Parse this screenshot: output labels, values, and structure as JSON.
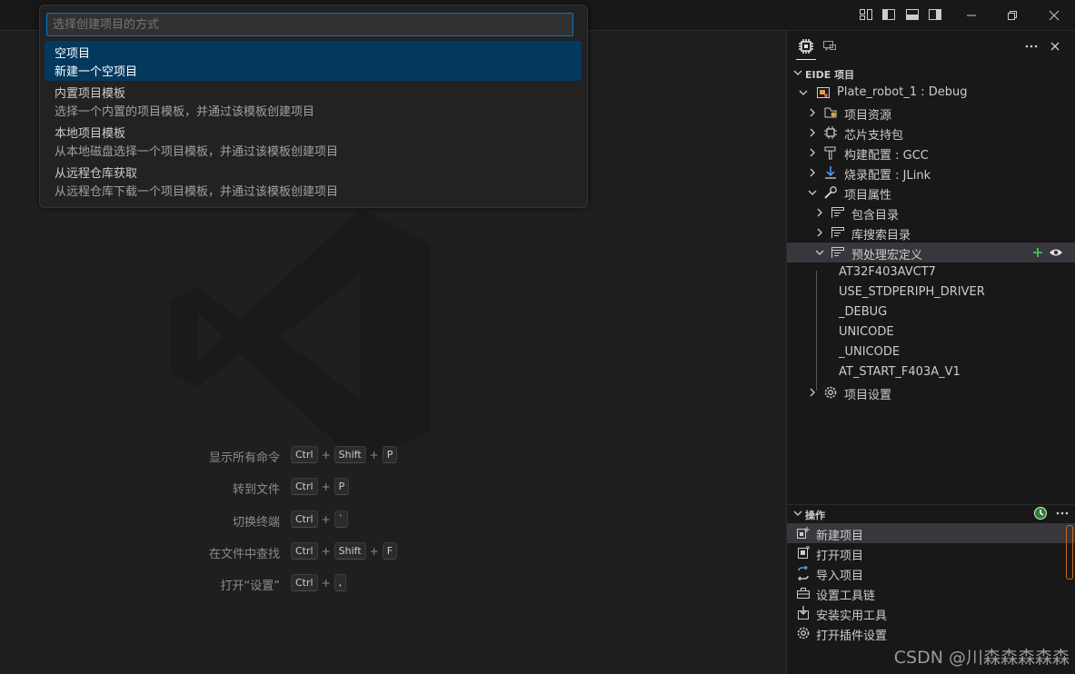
{
  "quickpick": {
    "placeholder": "选择创建项目的方式",
    "items": [
      {
        "title": "空项目",
        "desc": "新建一个空项目",
        "selected": true
      },
      {
        "title": "内置项目模板",
        "desc": "选择一个内置的项目模板，并通过该模板创建项目",
        "selected": false
      },
      {
        "title": "本地项目模板",
        "desc": "从本地磁盘选择一个项目模板，并通过该模板创建项目",
        "selected": false
      },
      {
        "title": "从远程仓库获取",
        "desc": "从远程仓库下载一个项目模板，并通过该模板创建项目",
        "selected": false
      }
    ]
  },
  "shortcuts": [
    {
      "label": "显示所有命令",
      "keys": [
        "Ctrl",
        "Shift",
        "P"
      ]
    },
    {
      "label": "转到文件",
      "keys": [
        "Ctrl",
        "P"
      ]
    },
    {
      "label": "切换终端",
      "keys": [
        "Ctrl",
        "`"
      ]
    },
    {
      "label": "在文件中查找",
      "keys": [
        "Ctrl",
        "Shift",
        "F"
      ]
    },
    {
      "label": "打开“设置”",
      "keys": [
        "Ctrl",
        ","
      ]
    }
  ],
  "sidebar": {
    "project_section": "EIDE 项目",
    "project_name": "Plate_robot_1 : Debug",
    "tree": {
      "resources": "项目资源",
      "chip_pack": "芯片支持包",
      "build_config": "构建配置 : GCC",
      "flash_config": "烧录配置 : JLink",
      "properties": "项目属性",
      "include_dirs": "包含目录",
      "lib_dirs": "库搜索目录",
      "macros": "预处理宏定义",
      "macro_values": [
        "AT32F403AVCT7",
        "USE_STDPERIPH_DRIVER",
        "_DEBUG",
        "UNICODE",
        "_UNICODE",
        "AT_START_F403A_V1"
      ],
      "settings": "项目设置"
    },
    "ops_section": "操作",
    "ops": [
      "新建项目",
      "打开项目",
      "导入项目",
      "设置工具链",
      "安装实用工具",
      "打开插件设置"
    ]
  },
  "watermark": "CSDN @川森森森森森",
  "colors": {
    "accent": "#0078d4",
    "selected": "#04395e",
    "green_add": "#3fb950"
  }
}
